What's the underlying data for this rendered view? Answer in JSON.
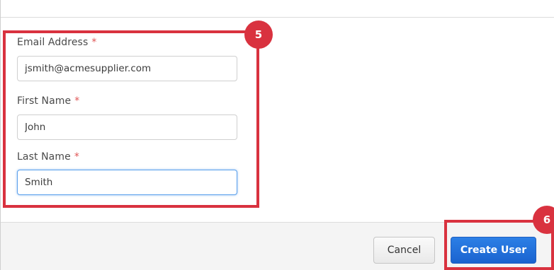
{
  "form": {
    "email": {
      "label": "Email Address",
      "required_marker": "*",
      "value": "jsmith@acmesupplier.com"
    },
    "first_name": {
      "label": "First Name",
      "required_marker": "*",
      "value": "John"
    },
    "last_name": {
      "label": "Last Name",
      "required_marker": "*",
      "value": "Smith"
    }
  },
  "footer": {
    "cancel_label": "Cancel",
    "create_label": "Create User"
  },
  "annotations": {
    "form_step": "5",
    "button_step": "6",
    "color": "#d9323f"
  },
  "colors": {
    "primary_button": "#1a63cf",
    "required_asterisk": "#e05555",
    "focus_border": "#5aa0ec"
  }
}
